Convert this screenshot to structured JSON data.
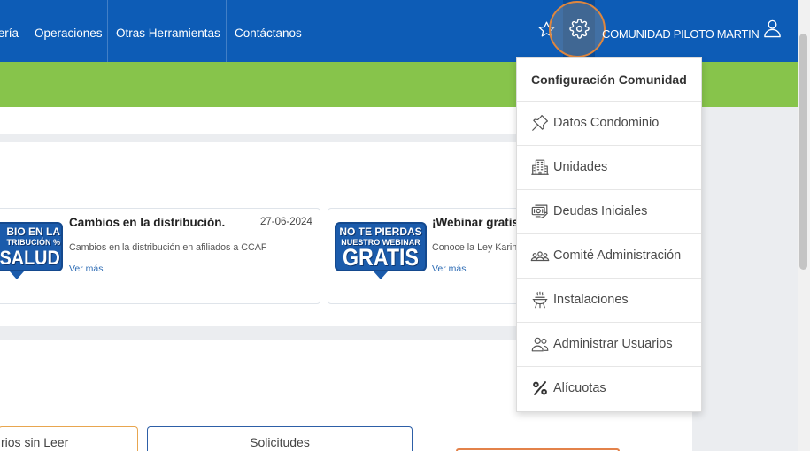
{
  "navbar": {
    "items": [
      {
        "label": "ería"
      },
      {
        "label": "Operaciones"
      },
      {
        "label": "Otras Herramientas"
      },
      {
        "label": "Contáctanos"
      }
    ],
    "favorites_icon": "star-icon",
    "settings_icon": "gear-icon",
    "community_name": "COMUNIDAD PILOTO MARTIN",
    "user_icon": "user-icon"
  },
  "settings_menu": {
    "title": "Configuración Comunidad",
    "items": [
      {
        "label": "Datos Condominio",
        "icon": "pushpin-icon"
      },
      {
        "label": "Unidades",
        "icon": "building-icon"
      },
      {
        "label": "Deudas Iniciales",
        "icon": "money-icon"
      },
      {
        "label": "Comité Administración",
        "icon": "committee-icon"
      },
      {
        "label": "Instalaciones",
        "icon": "grill-icon"
      },
      {
        "label": "Administrar Usuarios",
        "icon": "users-icon"
      },
      {
        "label": "Alícuotas",
        "icon": "percent-icon"
      }
    ]
  },
  "news": [
    {
      "badge_lines": [
        "BIO EN LA",
        "TRIBUCIÓN %",
        "SALUD"
      ],
      "title": "Cambios en la distribución.",
      "date": "27-06-2024",
      "summary": "Cambios en la distribución en afiliados a CCAF",
      "link": "Ver más"
    },
    {
      "badge_lines": [
        "NO TE PIERDAS",
        "NUESTRO WEBINAR",
        "GRATIS"
      ],
      "title": "¡Webinar gratis",
      "summary": "Conoce la Ley Karin",
      "link": "Ver más"
    }
  ],
  "tabs": [
    {
      "label": "rios sin Leer"
    },
    {
      "label": "Solicitudes"
    }
  ],
  "colors": {
    "navbar": "#0d5cb6",
    "navbar_active": "#0a4c98",
    "green_bar": "#87c44b",
    "link": "#2f6db5",
    "badge": "#1b5bab",
    "tab_unread_border": "#e8a64f",
    "tab_requests_border": "#2d5fa7",
    "orange_button": "#e3824a",
    "click_ring": "#de863e"
  }
}
